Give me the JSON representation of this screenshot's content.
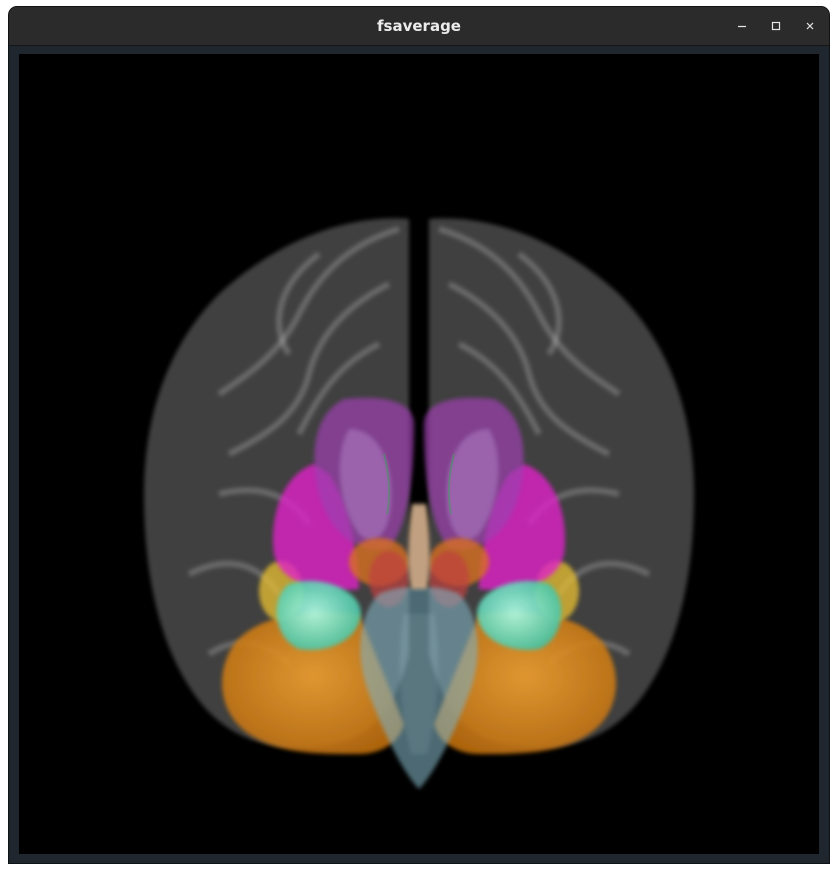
{
  "window": {
    "title": "fsaverage"
  },
  "controls": {
    "minimize_icon": "minimize-icon",
    "maximize_icon": "maximize-icon",
    "close_icon": "close-icon"
  },
  "scene": {
    "background": "#000000",
    "cortex_color": "#c8c8c8",
    "structures": [
      {
        "name": "cortex",
        "color": "#c8c8c8"
      },
      {
        "name": "putamen",
        "color": "#9e3fb0"
      },
      {
        "name": "pallidum",
        "color": "#e020c8"
      },
      {
        "name": "thalamus",
        "color": "#c86020"
      },
      {
        "name": "hippocampus",
        "color": "#e8c030"
      },
      {
        "name": "amygdala",
        "color": "#70f0d0"
      },
      {
        "name": "cerebellum",
        "color": "#e08a20"
      },
      {
        "name": "brainstem",
        "color": "#80b0c0"
      },
      {
        "name": "ventral-dc",
        "color": "#c04040"
      },
      {
        "name": "ventricles",
        "color": "#f0c8a0"
      }
    ]
  }
}
